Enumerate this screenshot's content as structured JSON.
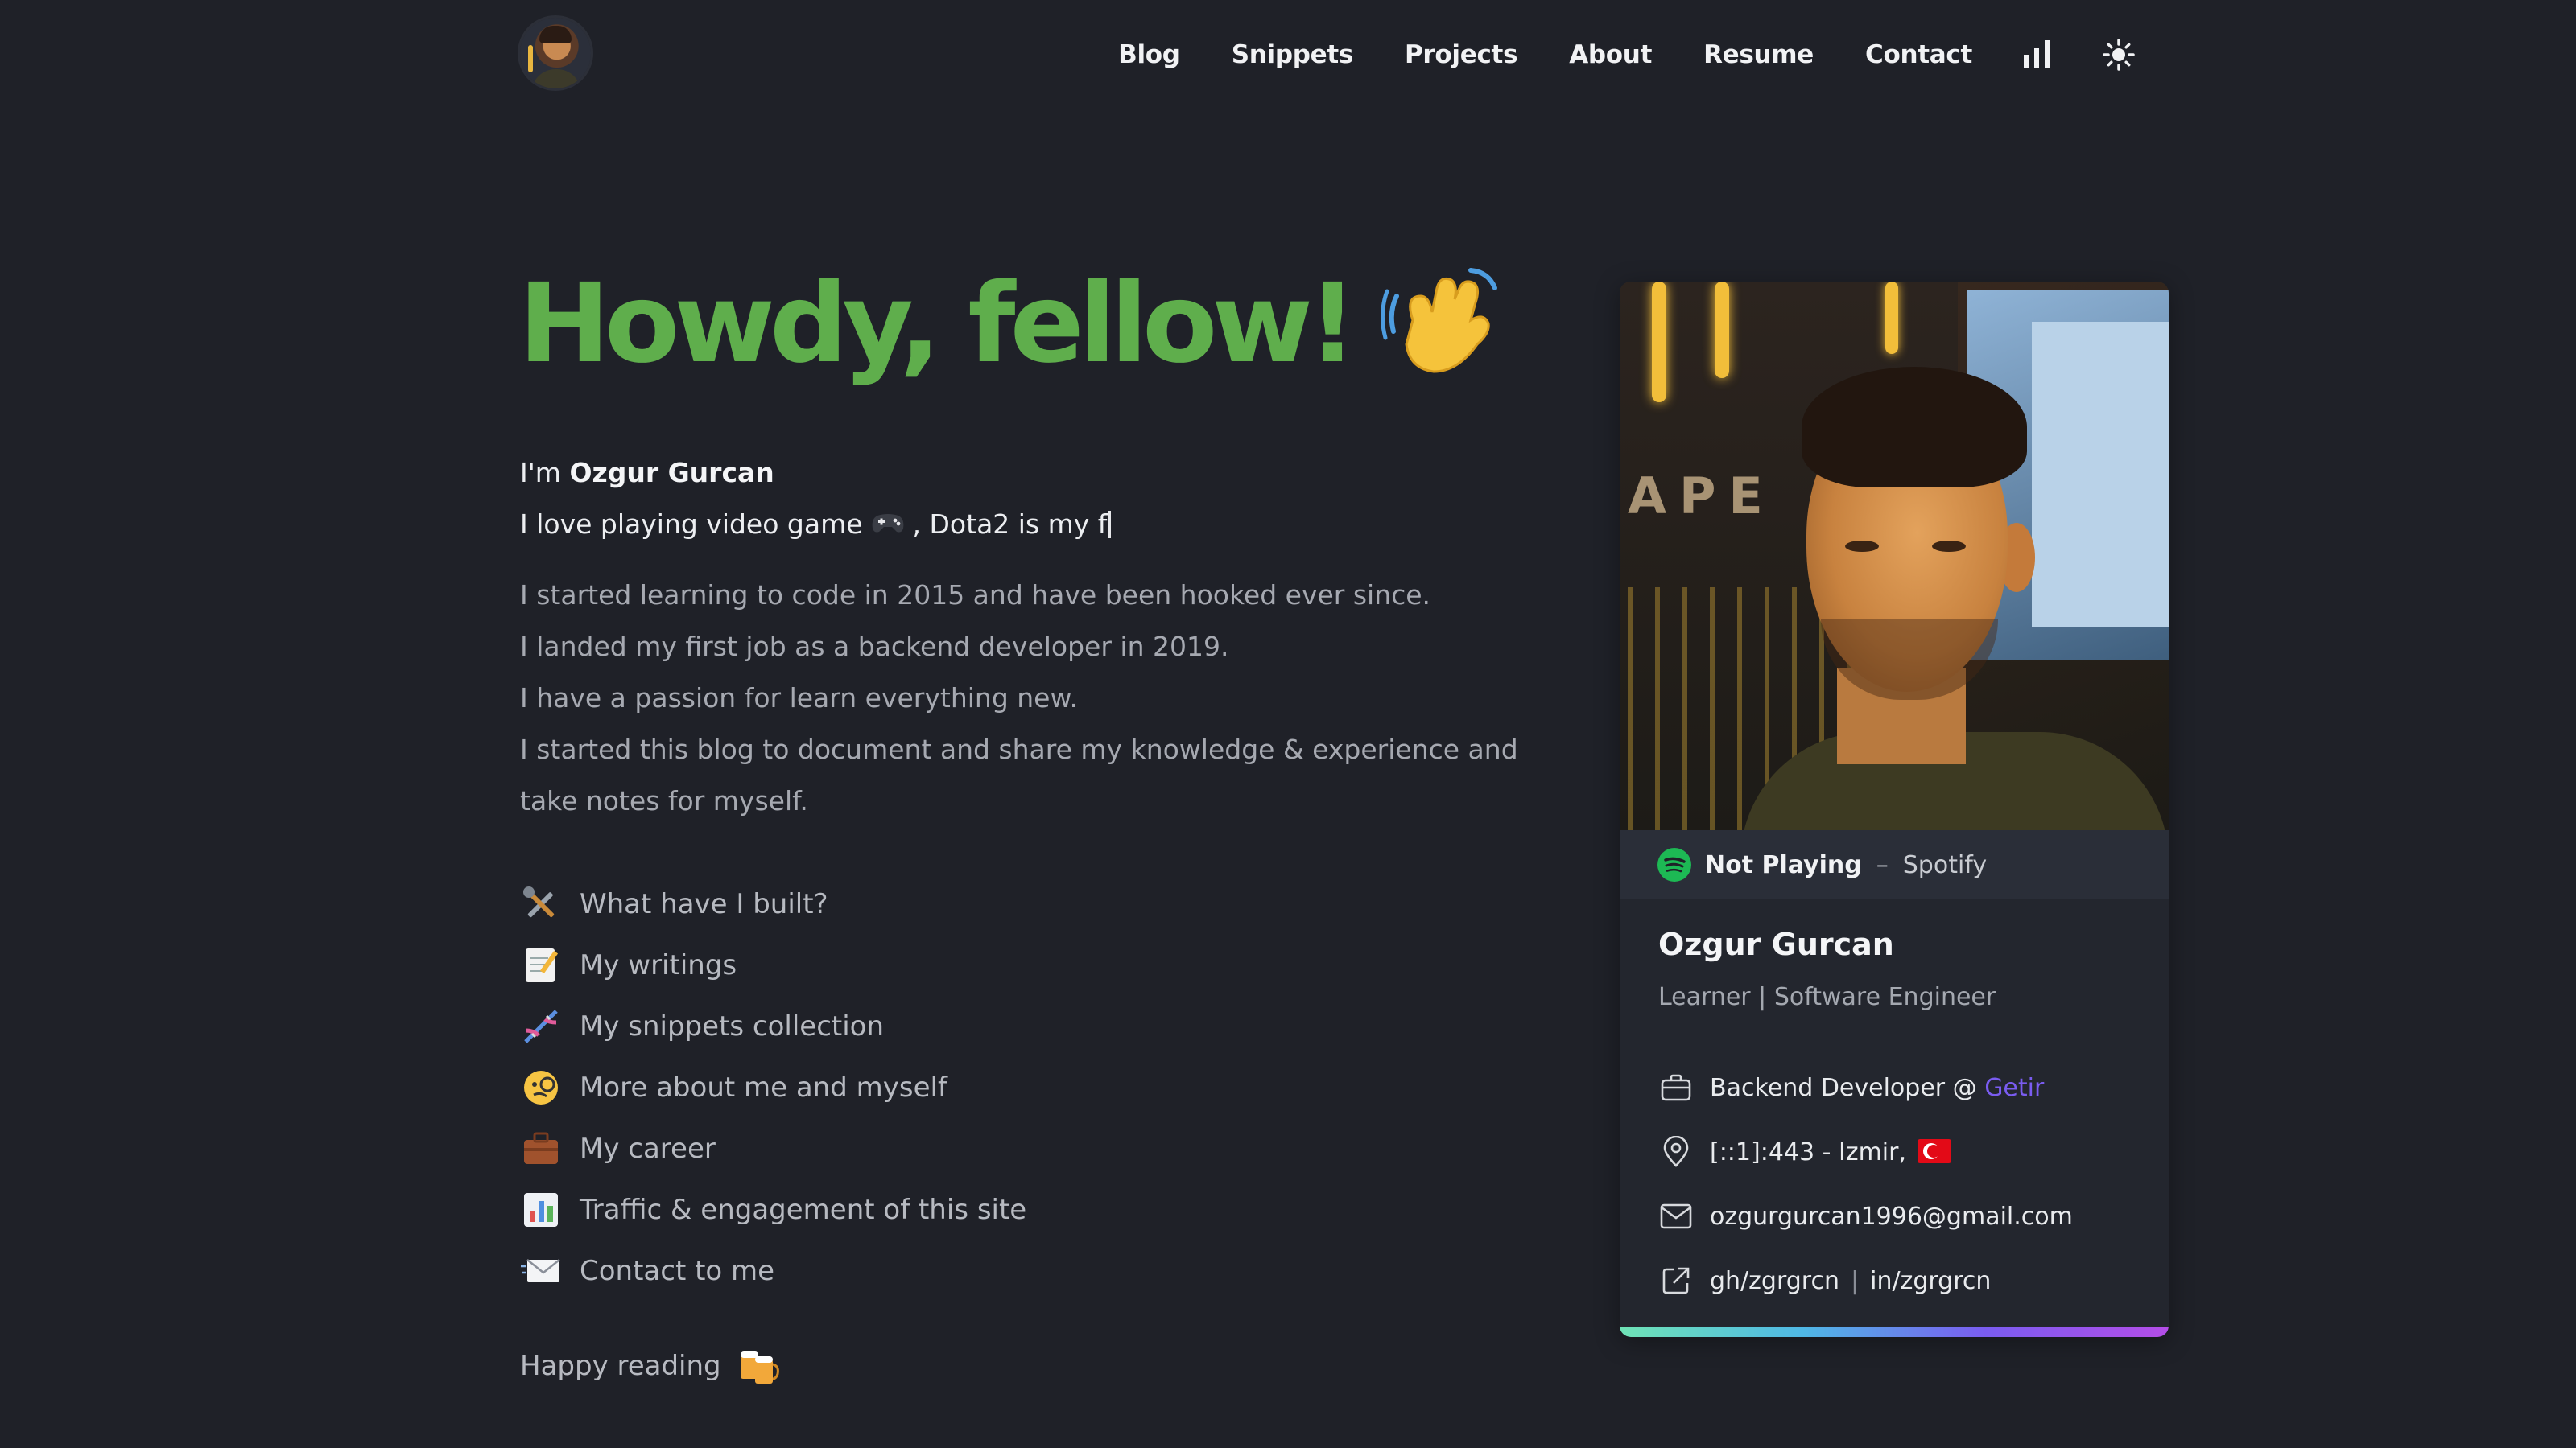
{
  "nav": {
    "items": [
      {
        "label": "Blog"
      },
      {
        "label": "Snippets"
      },
      {
        "label": "Projects"
      },
      {
        "label": "About"
      },
      {
        "label": "Resume"
      },
      {
        "label": "Contact"
      }
    ],
    "icons": [
      "stats-icon",
      "sun-icon"
    ]
  },
  "hero": {
    "heading": "Howdy, fellow!",
    "heading_color": "#5fae4c",
    "emoji": "waving-hand-icon"
  },
  "intro": {
    "prefix": "I'm ",
    "name": "Ozgur Gurcan",
    "line2_before": "I love playing video game",
    "line2_after": ", Dota2 is my f"
  },
  "bio": [
    "I started learning to code in 2015 and have been hooked ever since.",
    "I landed my first job as a backend developer in 2019.",
    "I have a passion for learn everything new.",
    "I started this blog to document and share my knowledge & experience and take notes for myself."
  ],
  "links": [
    {
      "icon": "tools-icon",
      "label": "What have I built?"
    },
    {
      "icon": "memo-icon",
      "label": "My writings"
    },
    {
      "icon": "dna-icon",
      "label": "My snippets collection"
    },
    {
      "icon": "monocle-face-icon",
      "label": "More about me and myself"
    },
    {
      "icon": "briefcase-icon",
      "label": "My career"
    },
    {
      "icon": "bar-chart-icon",
      "label": "Traffic & engagement of this site"
    },
    {
      "icon": "envelope-icon",
      "label": "Contact to me"
    }
  ],
  "footer": {
    "happy": "Happy reading",
    "emoji": "beer-mugs-icon"
  },
  "card": {
    "spotify_status": "Not Playing",
    "spotify_dash": "–",
    "spotify_label": "Spotify",
    "name": "Ozgur Gurcan",
    "role": "Learner | Software Engineer",
    "job_prefix": "Backend Developer @ ",
    "job_company": "Getir",
    "location": "[::1]:443 - Izmir,",
    "email": "ozgurgurcan1996@gmail.com",
    "social_gh": "gh/zgrgrcn",
    "social_sep": "|",
    "social_in": "in/zgrgrcn",
    "accent_link_color": "#7a5cf0",
    "spotify_color": "#1db954"
  }
}
